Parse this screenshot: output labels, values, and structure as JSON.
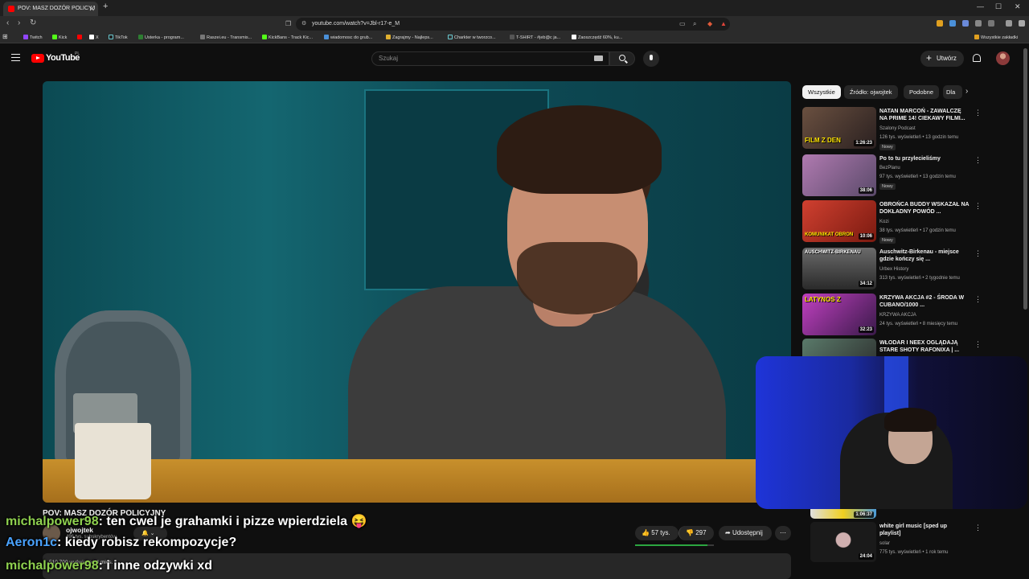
{
  "browser": {
    "tab_title": "POV: MASZ DOZÓR POLICYJ",
    "url": "youtube.com/watch?v=Jbl-r17-e_M",
    "bookmarks": [
      "Twitch",
      "Kick",
      "X",
      "TikTok",
      "Usterka - program...",
      "Raszei.eu - Transmis...",
      "KickBans - Track Kic...",
      "wiadomosc do grub...",
      "Zagrajmy - Najleps...",
      "Charkter w tworzco...",
      "T-SHIRT - #jeb@c ja...",
      "Zaoszczędź 60%, ku..."
    ],
    "all_bookmarks": "Wszystkie zakładki"
  },
  "yt": {
    "logo": "YouTube",
    "country": "PL",
    "search_placeholder": "Szukaj",
    "create": "Utwórz"
  },
  "video": {
    "title": "POV: MASZ DOZÓR POLICYJNY",
    "channel": "ojwojtek",
    "subs": "496 tys. subskrybentów",
    "likes": "57 tys.",
    "dislikes": "297",
    "share": "Udostępnij",
    "like_ratio": 0.92,
    "desc_meta": "510 700 wyświetleń  4 mies."
  },
  "chips": [
    "Wszystkie",
    "Źródło: ojwojtek",
    "Podobne",
    "Dla"
  ],
  "recommended": [
    {
      "title": "NATAN MARCOŃ - ZAWALCZĘ NA PRIME 14! CIEKAWY FILMI...",
      "channel": "Szalony Podcast",
      "meta": "126 tys. wyświetleń • 13 godzin temu",
      "badge": "Nowy",
      "dur": "1:26:23",
      "thumb_text": "FILM Z DEN",
      "thumb_color": "#3b2a22"
    },
    {
      "title": "Po to tu przylecieliśmy",
      "channel": "BezPlanu",
      "meta": "97 tys. wyświetleń • 13 godzin temu",
      "badge": "Nowy",
      "dur": "38:06",
      "thumb_text": "",
      "thumb_color": "#5a4a6a"
    },
    {
      "title": "OBROŃCA BUDDY WSKAZAŁ NA DOKŁADNY POWÓD ...",
      "channel": "Kozi",
      "meta": "38 tys. wyświetleń • 17 godzin temu",
      "badge": "Nowy",
      "dur": "10:06",
      "thumb_text": "KOMUNIKAT OBRON",
      "thumb_color": "#c0392b"
    },
    {
      "title": "Auschwitz-Birkenau - miejsce gdzie kończy się ...",
      "channel": "Urbex History",
      "meta": "313 tys. wyświetleń • 2 tygodnie temu",
      "badge": "",
      "dur": "34:12",
      "thumb_text": "AUSCHWITZ-BIRKENAU",
      "thumb_color": "#4a4a4a"
    },
    {
      "title": "KRZYWA AKCJA #2 - ŚRODA W CUBANO/1000 ...",
      "channel": "KRZYWA AKCJA",
      "meta": "24 tys. wyświetleń • 8 miesięcy temu",
      "badge": "",
      "dur": "32:23",
      "thumb_text": "LATYNOS Z",
      "thumb_color": "#7a2a8a"
    },
    {
      "title": "WŁODAR I NEEX OGLĄDAJĄ STARE SHOTY RAFONIXA | ...",
      "channel": "",
      "meta": "",
      "badge": "",
      "dur": "",
      "thumb_text": "",
      "thumb_color": "#3a3a3a"
    },
    {
      "title": "white girl music [sped up playlist]",
      "channel": "solar",
      "meta": "775 tys. wyświetleń • 1 rok temu",
      "badge": "",
      "dur": "24:04",
      "thumb_text": "",
      "thumb_color": "#222"
    }
  ],
  "partial_duration": "1:06:37",
  "chat": [
    {
      "user": "michalpower98",
      "msg": ": ten cwel je grahamki i pizze wpierdziela 😝"
    },
    {
      "user": "Aeron1c",
      "msg": ": kiedy robisz rekompozycje?"
    },
    {
      "user": "michalpower98",
      "msg": ": i inne odzywki  xd"
    }
  ]
}
